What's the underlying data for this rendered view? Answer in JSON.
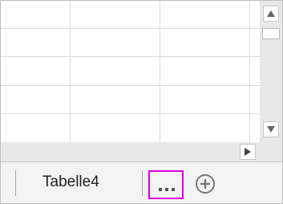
{
  "sheet_tabs": {
    "active_tab_label": "Tabelle4",
    "more_sheets_label": "...",
    "add_sheet_label": "+"
  },
  "colors": {
    "highlight_border": "#e000e0",
    "gridline": "#dadada",
    "scrollbar_track": "#e8e8e8",
    "tabbar_bg": "#f3f3f3"
  },
  "icons": {
    "scroll_up": "triangle-up-icon",
    "scroll_down": "triangle-down-icon",
    "scroll_right": "triangle-right-icon",
    "add_sheet": "plus-circle-icon",
    "more": "ellipsis-icon"
  }
}
